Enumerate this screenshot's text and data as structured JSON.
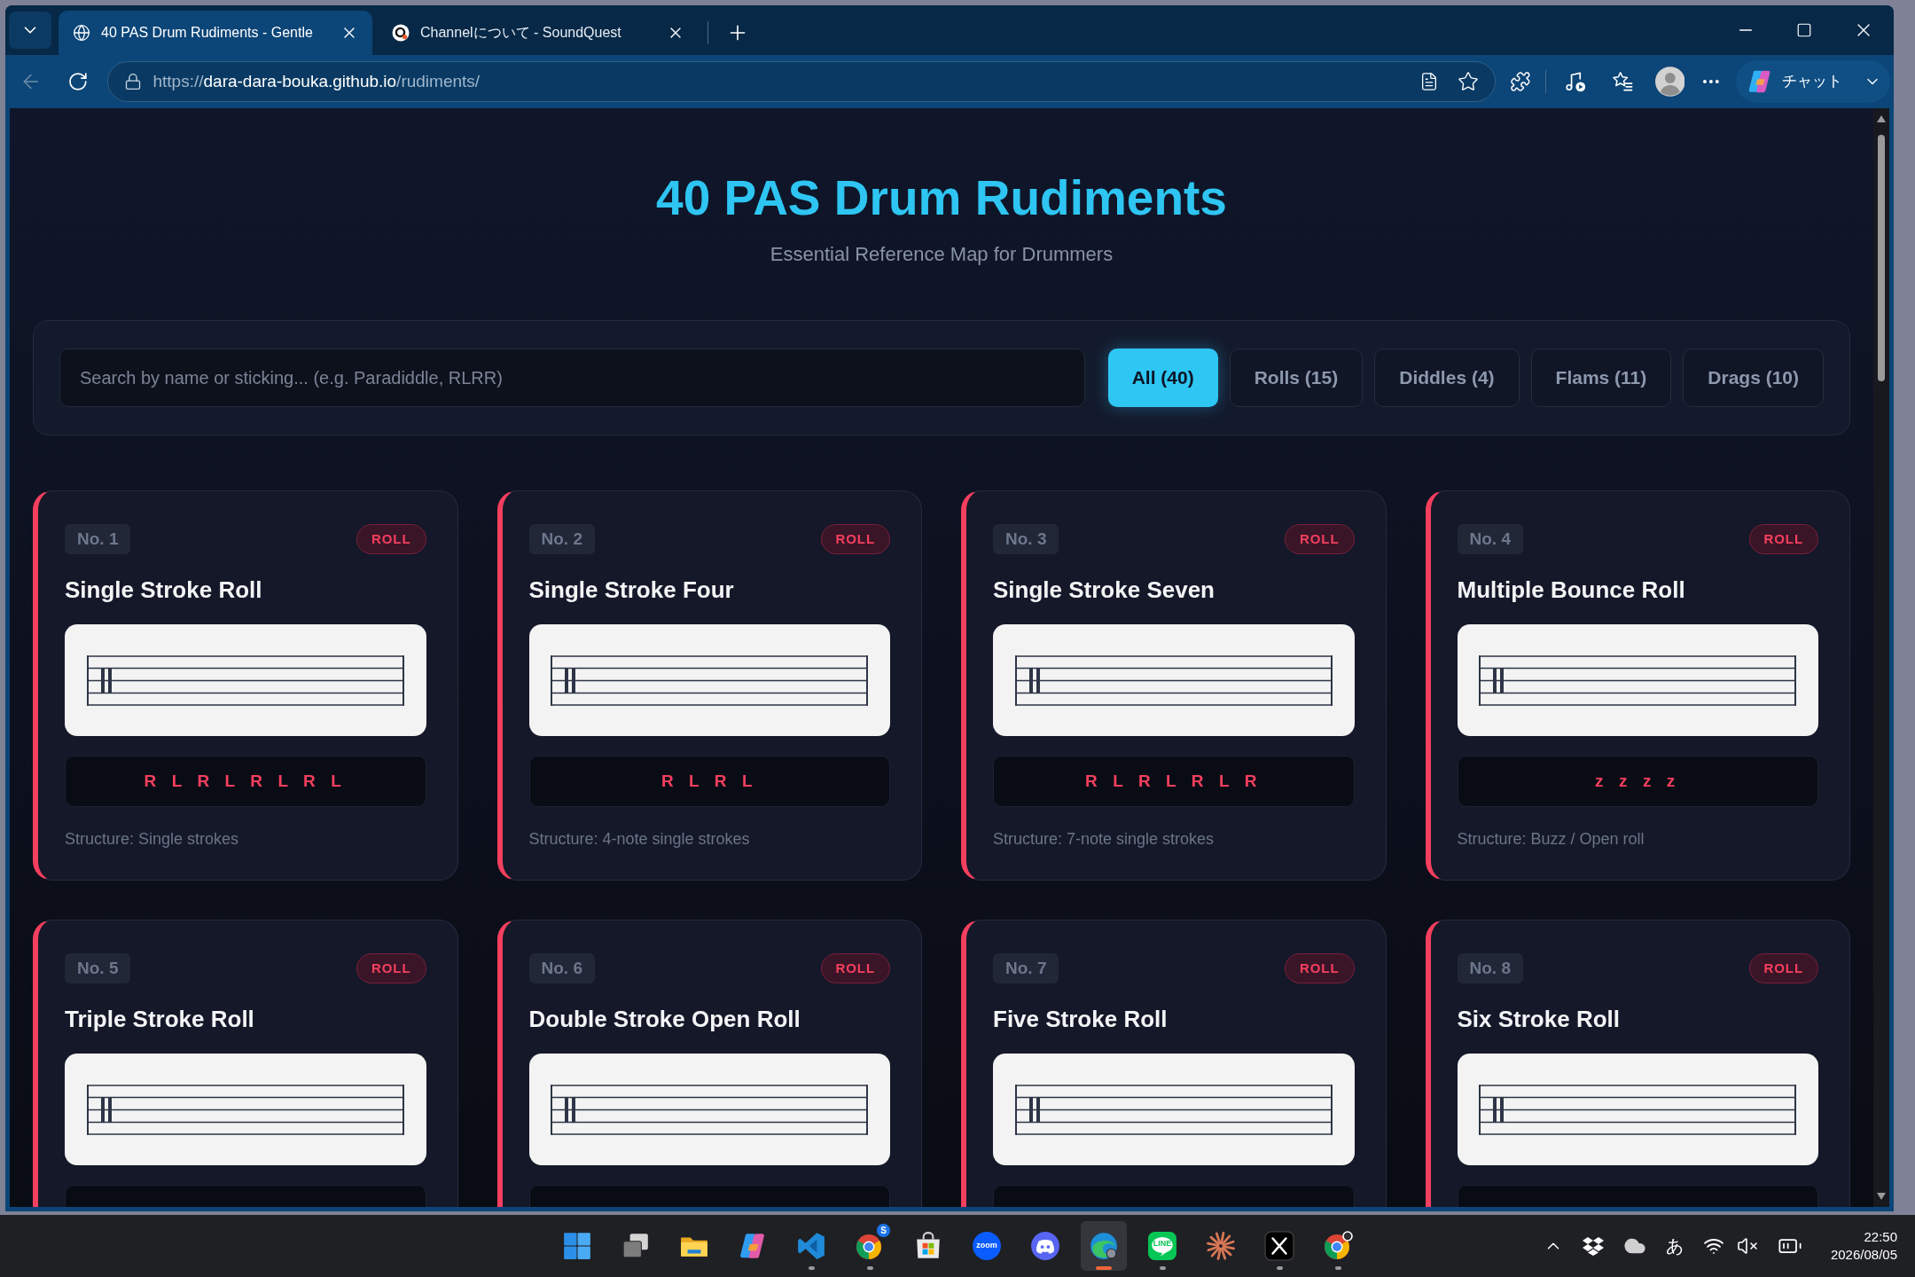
{
  "browser": {
    "tabs": [
      {
        "title": "40 PAS Drum Rudiments - Gentle",
        "selected": true
      },
      {
        "title": "Channelについて - SoundQuest",
        "selected": false
      }
    ],
    "back": {
      "disabled": true
    },
    "address": {
      "scheme": "https://",
      "host": "dara-dara-bouka.github.io",
      "path": "/rudiments/"
    },
    "copilot": {
      "label": "チャット"
    }
  },
  "page": {
    "header": {
      "title": "40 PAS Drum Rudiments",
      "subtitle": "Essential Reference Map for Drummers"
    },
    "search": {
      "placeholder": "Search by name or sticking... (e.g. Paradiddle, RLRR)"
    },
    "filters": [
      {
        "label": "All (40)",
        "selected": true
      },
      {
        "label": "Rolls (15)",
        "selected": false
      },
      {
        "label": "Diddles (4)",
        "selected": false
      },
      {
        "label": "Flams (11)",
        "selected": false
      },
      {
        "label": "Drags (10)",
        "selected": false
      }
    ],
    "cards": [
      {
        "number": "No. 1",
        "category": "ROLL",
        "title": "Single Stroke Roll",
        "sticking": "R L R L R L R L",
        "structure": "Structure: Single strokes"
      },
      {
        "number": "No. 2",
        "category": "ROLL",
        "title": "Single Stroke Four",
        "sticking": "R L R L",
        "structure": "Structure: 4-note single strokes"
      },
      {
        "number": "No. 3",
        "category": "ROLL",
        "title": "Single Stroke Seven",
        "sticking": "R L R L R L R",
        "structure": "Structure: 7-note single strokes"
      },
      {
        "number": "No. 4",
        "category": "ROLL",
        "title": "Multiple Bounce Roll",
        "sticking": "z z z z",
        "structure": "Structure: Buzz / Open roll"
      },
      {
        "number": "No. 5",
        "category": "ROLL",
        "title": "Triple Stroke Roll"
      },
      {
        "number": "No. 6",
        "category": "ROLL",
        "title": "Double Stroke Open Roll"
      },
      {
        "number": "No. 7",
        "category": "ROLL",
        "title": "Five Stroke Roll"
      },
      {
        "number": "No. 8",
        "category": "ROLL",
        "title": "Six Stroke Roll"
      }
    ]
  },
  "taskbar": {
    "apps": [
      {
        "running": false,
        "selected": false
      },
      {
        "running": false,
        "selected": false
      },
      {
        "running": false,
        "selected": false
      },
      {
        "running": false,
        "selected": false
      },
      {
        "running": true,
        "selected": false
      },
      {
        "running": true,
        "selected": false,
        "badge": "S"
      },
      {
        "running": false,
        "selected": false
      },
      {
        "running": false,
        "selected": false,
        "label": "zoom"
      },
      {
        "running": false,
        "selected": false
      },
      {
        "running": true,
        "selected": true
      },
      {
        "running": true,
        "selected": false,
        "label": "LINE"
      },
      {
        "running": false,
        "selected": false
      },
      {
        "running": true,
        "selected": false
      },
      {
        "running": true,
        "selected": false
      }
    ],
    "ime": "あ",
    "time": "22:50",
    "date": "2026/08/05"
  }
}
